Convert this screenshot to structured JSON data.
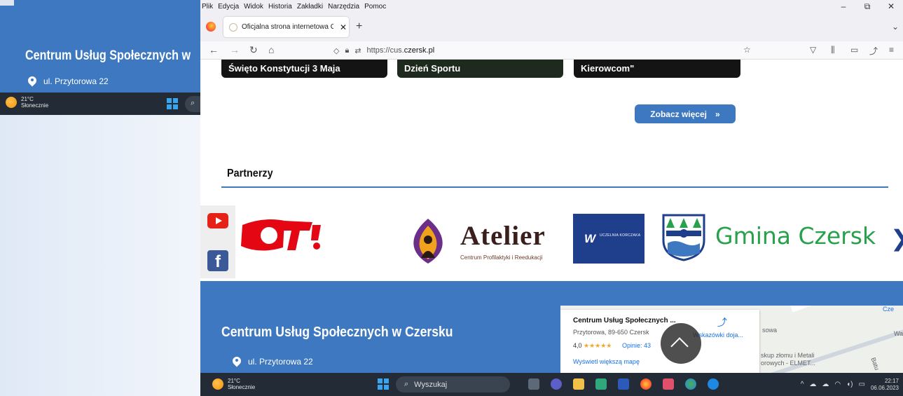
{
  "preview": {
    "title": "Centrum Usług Społecznych w",
    "address": "ul. Przytorowa 22",
    "weather": {
      "temp": "21°C",
      "desc": "Słonecznie"
    }
  },
  "menubar": {
    "items": [
      "Plik",
      "Edycja",
      "Widok",
      "Historia",
      "Zakładki",
      "Narzędzia",
      "Pomoc"
    ]
  },
  "window_controls": {
    "minimize": "–",
    "restore": "⧉",
    "close": "✕"
  },
  "tab": {
    "title": "Oficjalna strona internetowa Ce",
    "close": "✕"
  },
  "url": {
    "prefix": "https://cus.",
    "domain": "czersk.pl"
  },
  "cards": [
    {
      "label": "Święto Konstytucji 3 Maja"
    },
    {
      "label": "Dzień Sportu"
    },
    {
      "label": "Kierowcom\""
    }
  ],
  "more_button": {
    "label": "Zobacz więcej",
    "arrow": "»"
  },
  "partners": {
    "title": "Partnerzy",
    "atelier_name": "Atelier",
    "atelier_sub": "Centrum Profilaktyki i Reedukacji",
    "uk_mark": "W",
    "uk_text": "UCZELNIA KORCZAKA",
    "gmina": "Gmina Czersk",
    "next": "❯"
  },
  "footer": {
    "title": "Centrum Usług Społecznych w Czersku",
    "address": "ul. Przytorowa 22"
  },
  "map": {
    "name": "Centrum Usług Społecznych ...",
    "address": "Przytorowa, 89-650 Czersk",
    "rating": "4,0",
    "stars": "★★★★★",
    "reviews": "Opinie: 43",
    "bigger_map": "Wyświetl większą mapę",
    "directions": "Wskazówki doja...",
    "labels": [
      "sowa",
      "Cze",
      "skup złomu i Metali",
      "orowych - ELMET...",
      "Batu",
      "Wa"
    ]
  },
  "taskbar": {
    "weather": {
      "temp": "21°C",
      "desc": "Słonecznie"
    },
    "search": "Wyszukaj",
    "time": "22:17",
    "date": "06.06.2023"
  },
  "colors": {
    "brand_blue": "#3d78c0",
    "taskbar": "#232b36",
    "gmina_green": "#27a14a"
  }
}
